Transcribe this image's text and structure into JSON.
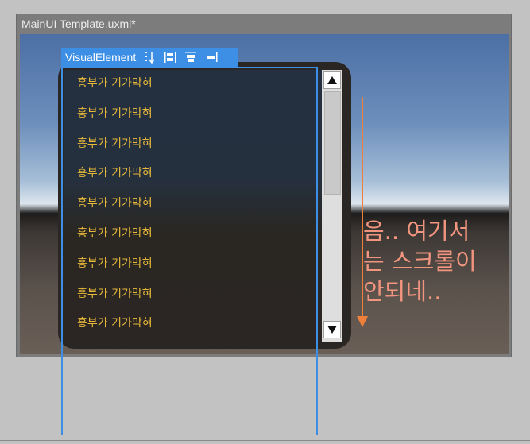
{
  "canvas": {
    "title": "MainUI Template.uxml*"
  },
  "selection": {
    "label": "VisualElement"
  },
  "list": {
    "items": [
      "흥부가 기가막혀",
      "흥부가 기가막혀",
      "흥부가 기가막혀",
      "흥부가 기가막혀",
      "흥부가 기가막혀",
      "흥부가 기가막혀",
      "흥부가 기가막혀",
      "흥부가 기가막혀",
      "흥부가 기가막혀"
    ],
    "scroll_up_icon": "triangle-up-icon",
    "scroll_down_icon": "triangle-down-icon"
  },
  "annotation": {
    "text": "음.. 여기서\n는 스크롤이\n안되네..",
    "color": "#f2957e",
    "arrow_color": "#f07f3c"
  },
  "colors": {
    "item_text": "#e9b93a",
    "selection_blue": "#3d8fe6",
    "panel": "#292623"
  }
}
